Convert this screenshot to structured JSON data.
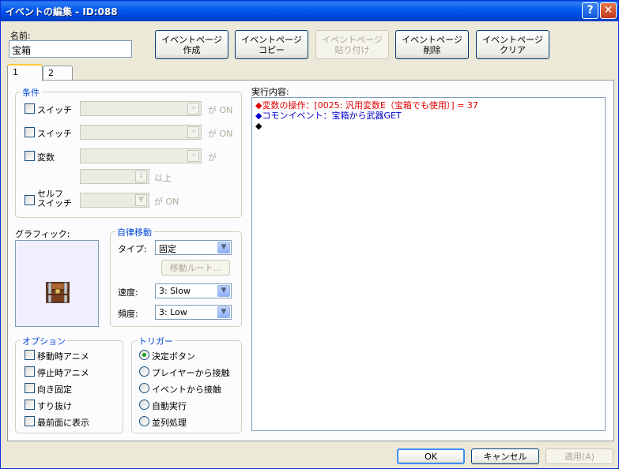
{
  "window": {
    "title": "イベントの編集 - ID:088",
    "help": "?",
    "close": "✕"
  },
  "name_label": "名前:",
  "name_value": "宝箱",
  "top_buttons": [
    {
      "line1": "イベントページ",
      "line2": "作成"
    },
    {
      "line1": "イベントページ",
      "line2": "コピー"
    },
    {
      "line1": "イベントページ",
      "line2": "貼り付け"
    },
    {
      "line1": "イベントページ",
      "line2": "削除"
    },
    {
      "line1": "イベントページ",
      "line2": "クリア"
    }
  ],
  "tabs": [
    "1",
    "2"
  ],
  "conditions": {
    "title": "条件",
    "switch1": "スイッチ",
    "switch1_suffix": "が ON",
    "switch2": "スイッチ",
    "switch2_suffix": "が ON",
    "variable": "変数",
    "variable_suffix": "が",
    "variable_ge": "以上",
    "self_switch_1": "セルフ",
    "self_switch_2": "スイッチ",
    "self_switch_suffix": "が ON"
  },
  "graphic_label": "グラフィック:",
  "movement": {
    "title": "自律移動",
    "type_label": "タイプ:",
    "type_value": "固定",
    "route_button": "移動ルート...",
    "speed_label": "速度:",
    "speed_value": "3: Slow",
    "freq_label": "頻度:",
    "freq_value": "3: Low"
  },
  "options": {
    "title": "オプション",
    "items": [
      "移動時アニメ",
      "停止時アニメ",
      "向き固定",
      "すり抜け",
      "最前面に表示"
    ]
  },
  "trigger": {
    "title": "トリガー",
    "items": [
      "決定ボタン",
      "プレイヤーから接触",
      "イベントから接触",
      "自動実行",
      "並列処理"
    ],
    "selected_index": 0
  },
  "content_label": "実行内容:",
  "content_lines": [
    {
      "text": "◆変数の操作：[0025: 汎用変数E（宝箱でも使用）] = 37",
      "color": "#e00000"
    },
    {
      "text": "◆コモンイベント：宝箱から武器GET",
      "color": "#0000cc"
    },
    {
      "text": "◆",
      "color": "#000000"
    }
  ],
  "footer": {
    "ok": "OK",
    "cancel": "キャンセル",
    "apply": "適用(A)"
  }
}
